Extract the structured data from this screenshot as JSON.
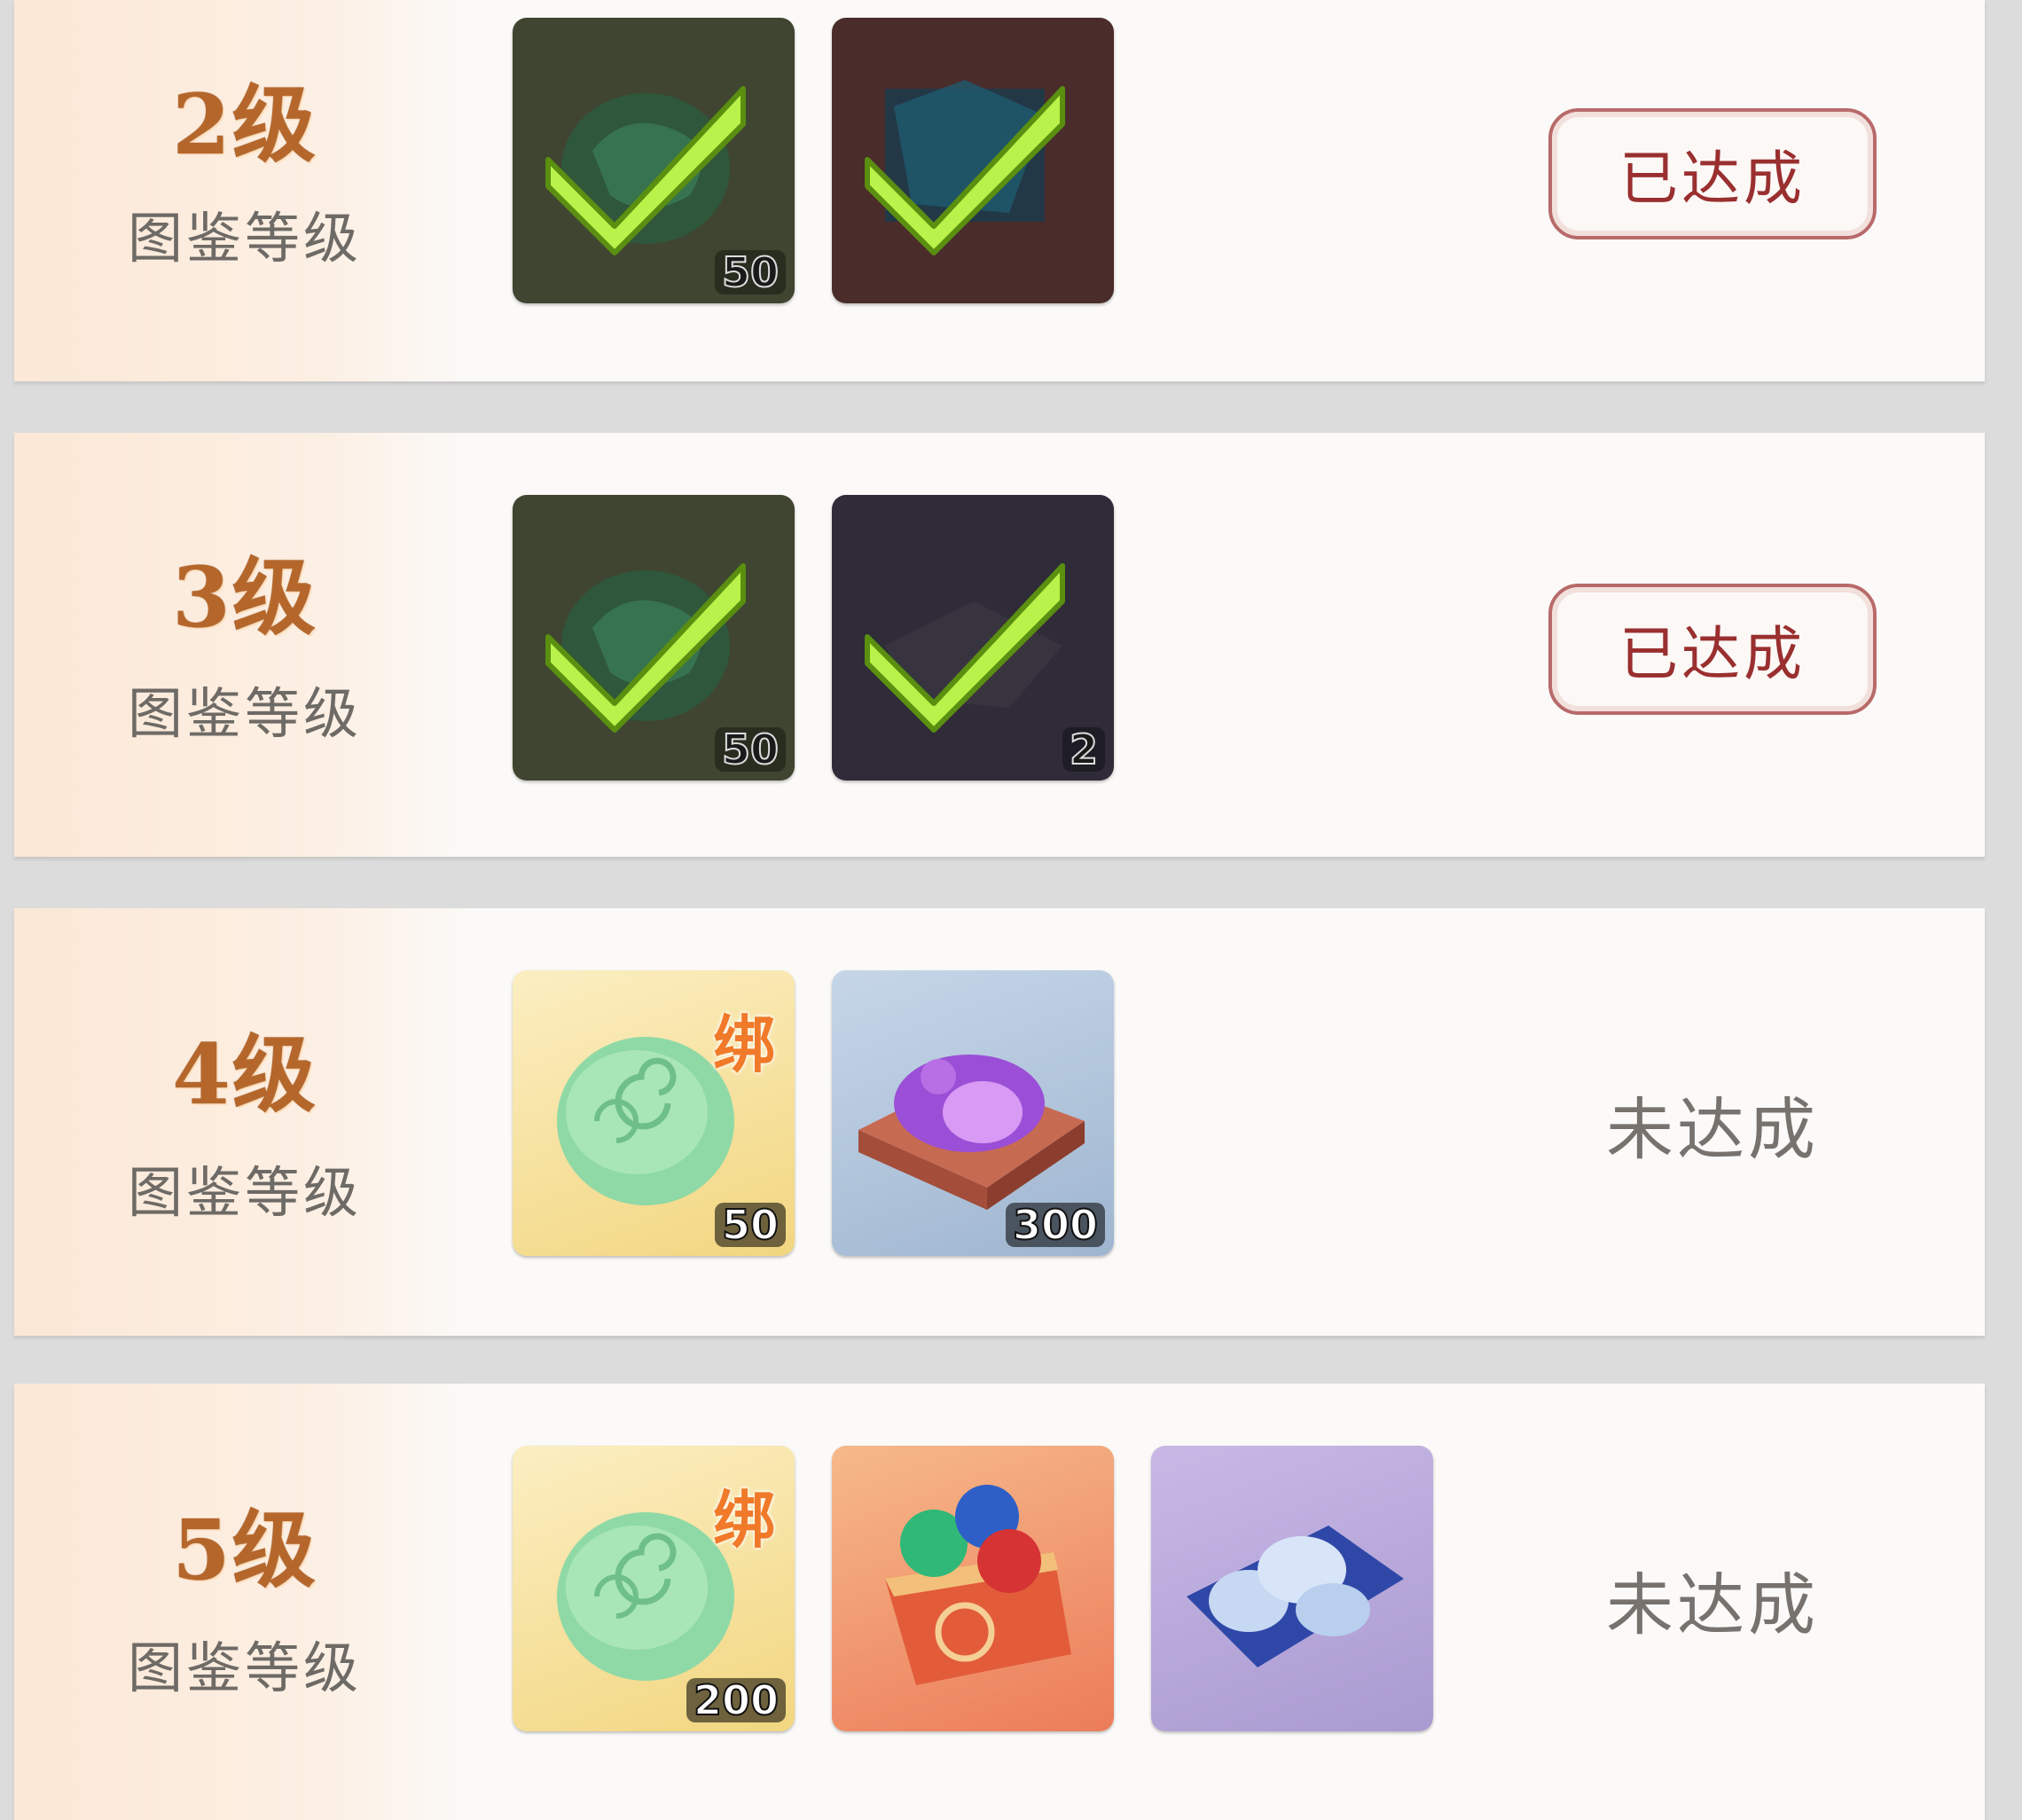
{
  "sublabel": "图鉴等级",
  "rows": [
    {
      "level": "2级",
      "status": "已达成",
      "items": [
        {
          "icon": "jade-cloud-icon",
          "qty": "50",
          "claimed": true
        },
        {
          "icon": "blue-crystal-icon",
          "qty": "",
          "claimed": true
        }
      ]
    },
    {
      "level": "3级",
      "status": "已达成",
      "items": [
        {
          "icon": "jade-cloud-icon",
          "qty": "50",
          "claimed": true
        },
        {
          "icon": "dark-box-icon",
          "qty": "2",
          "claimed": true
        }
      ]
    },
    {
      "level": "4级",
      "status": "未达成",
      "items": [
        {
          "icon": "jade-cloud-icon",
          "qty": "50",
          "bind": "绑"
        },
        {
          "icon": "purple-crystal-chest-icon",
          "qty": "300"
        }
      ]
    },
    {
      "level": "5级",
      "status": "未达成",
      "items": [
        {
          "icon": "jade-cloud-icon",
          "qty": "200",
          "bind": "绑"
        },
        {
          "icon": "gem-chest-icon",
          "qty": ""
        },
        {
          "icon": "silver-ore-icon",
          "qty": ""
        }
      ]
    }
  ]
}
